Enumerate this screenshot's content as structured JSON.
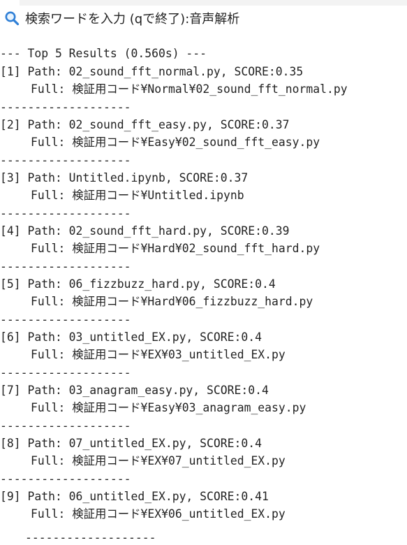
{
  "prompt": {
    "icon": "search-icon",
    "label": "検索ワードを入力 (qで終了): ",
    "value": "音声解析"
  },
  "header": "--- Top 5 Results (0.560s) ---",
  "separator": "-------------------",
  "results": [
    {
      "path_line": "[1] Path: 02_sound_fft_normal.py, SCORE:0.35",
      "full_line": "Full: 検証用コード¥Normal¥02_sound_fft_normal.py"
    },
    {
      "path_line": "[2] Path: 02_sound_fft_easy.py, SCORE:0.37",
      "full_line": "Full: 検証用コード¥Easy¥02_sound_fft_easy.py"
    },
    {
      "path_line": "[3] Path: Untitled.ipynb, SCORE:0.37",
      "full_line": "Full: 検証用コード¥Untitled.ipynb"
    },
    {
      "path_line": "[4] Path: 02_sound_fft_hard.py, SCORE:0.39",
      "full_line": "Full: 検証用コード¥Hard¥02_sound_fft_hard.py"
    },
    {
      "path_line": "[5] Path: 06_fizzbuzz_hard.py, SCORE:0.4",
      "full_line": "Full: 検証用コード¥Hard¥06_fizzbuzz_hard.py"
    },
    {
      "path_line": "[6] Path: 03_untitled_EX.py, SCORE:0.4",
      "full_line": "Full: 検証用コード¥EX¥03_untitled_EX.py"
    },
    {
      "path_line": "[7] Path: 03_anagram_easy.py, SCORE:0.4",
      "full_line": "Full: 検証用コード¥Easy¥03_anagram_easy.py"
    },
    {
      "path_line": "[8] Path: 07_untitled_EX.py, SCORE:0.4",
      "full_line": "Full: 検証用コード¥EX¥07_untitled_EX.py"
    },
    {
      "path_line": "[9] Path: 06_untitled_EX.py, SCORE:0.41",
      "full_line": "Full: 検証用コード¥EX¥06_untitled_EX.py"
    }
  ],
  "bottom_separator": "-------------------"
}
